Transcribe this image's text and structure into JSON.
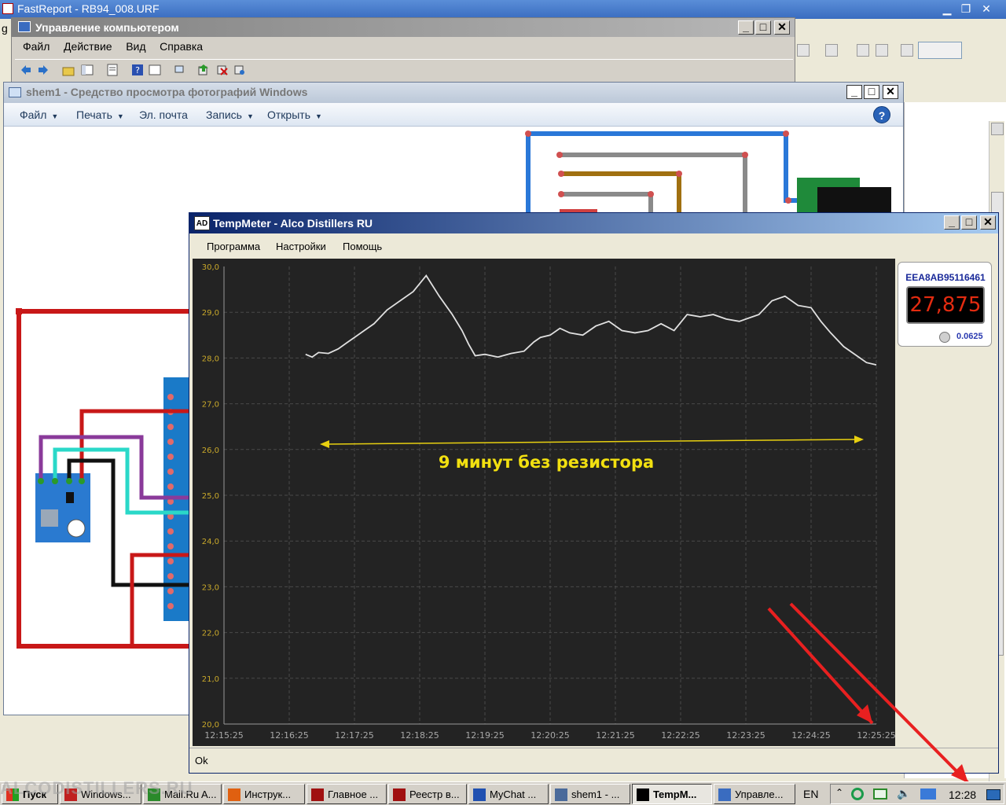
{
  "fastreport": {
    "title": "FastReport - RB94_008.URF",
    "left_letter": "g"
  },
  "compmgmt": {
    "title": "Управление компьютером",
    "menu": [
      "Файл",
      "Действие",
      "Вид",
      "Справка"
    ]
  },
  "photoviewer": {
    "title": "shem1 - Средство просмотра фотографий Windows",
    "menu": [
      "Файл",
      "Печать",
      "Эл. почта",
      "Запись",
      "Открыть"
    ],
    "help": "?"
  },
  "tempmeter": {
    "title": "TempMeter - Alco Distillers RU",
    "icon_text": "AD",
    "menu": [
      "Программа",
      "Настройки",
      "Помощь"
    ],
    "status": "Ok",
    "sensor": {
      "id": "EEA8AB95116461",
      "value": "27,875",
      "resolution": "0.0625"
    }
  },
  "chart_data": {
    "type": "line",
    "title": "",
    "xlabel": "",
    "ylabel": "",
    "ylim": [
      20.0,
      30.0
    ],
    "y_ticks": [
      "30,0",
      "29,0",
      "28,0",
      "27,0",
      "26,0",
      "25,0",
      "24,0",
      "23,0",
      "22,0",
      "21,0",
      "20,0"
    ],
    "x_ticks": [
      "12:15:25",
      "12:16:25",
      "12:17:25",
      "12:18:25",
      "12:19:25",
      "12:20:25",
      "12:21:25",
      "12:22:25",
      "12:23:25",
      "12:24:25",
      "12:25:25"
    ],
    "grid": true,
    "annotation": "9 минут без резистора",
    "series": [
      {
        "color": "#e0e0e0",
        "x_minutes": [
          1.25,
          1.35,
          1.45,
          1.6,
          1.75,
          1.9,
          2.0,
          2.15,
          2.3,
          2.5,
          2.7,
          2.9,
          3.1,
          3.3,
          3.5,
          3.65,
          3.75,
          3.85,
          4.0,
          4.2,
          4.4,
          4.6,
          4.75,
          4.85,
          5.0,
          5.15,
          5.3,
          5.5,
          5.7,
          5.9,
          6.1,
          6.3,
          6.5,
          6.7,
          6.9,
          7.1,
          7.3,
          7.5,
          7.7,
          7.9,
          8.0,
          8.2,
          8.4,
          8.6,
          8.8,
          9.0,
          9.15,
          9.3,
          9.5,
          9.7,
          9.85,
          10.0
        ],
        "y": [
          28.08,
          28.02,
          28.12,
          28.1,
          28.2,
          28.35,
          28.45,
          28.6,
          28.75,
          29.05,
          29.25,
          29.45,
          29.8,
          29.35,
          28.95,
          28.6,
          28.3,
          28.05,
          28.08,
          28.02,
          28.1,
          28.15,
          28.35,
          28.45,
          28.5,
          28.65,
          28.55,
          28.5,
          28.7,
          28.8,
          28.6,
          28.55,
          28.6,
          28.75,
          28.6,
          28.95,
          28.9,
          28.95,
          28.85,
          28.8,
          28.85,
          28.95,
          29.25,
          29.35,
          29.15,
          29.1,
          28.8,
          28.55,
          28.25,
          28.05,
          27.9,
          27.85
        ]
      }
    ]
  },
  "taskbar": {
    "start": "Пуск",
    "items": [
      {
        "label": "Windows...",
        "color": "#c02020"
      },
      {
        "label": "Mail.Ru A...",
        "color": "#2a8a2a"
      },
      {
        "label": "Инструк...",
        "color": "#e06010"
      },
      {
        "label": "Главное ...",
        "color": "#a01010"
      },
      {
        "label": "Реестр в...",
        "color": "#a01010"
      },
      {
        "label": "MyChat ...",
        "color": "#2050b0"
      },
      {
        "label": "shem1 - ...",
        "color": "#4a6a9a"
      },
      {
        "label": "TempM...",
        "color": "#000000"
      },
      {
        "label": "Управле...",
        "color": "#3a6cc0"
      }
    ],
    "lang": "EN",
    "clock": "12:28",
    "watermark": "ALCODISTILLERS.RU"
  }
}
